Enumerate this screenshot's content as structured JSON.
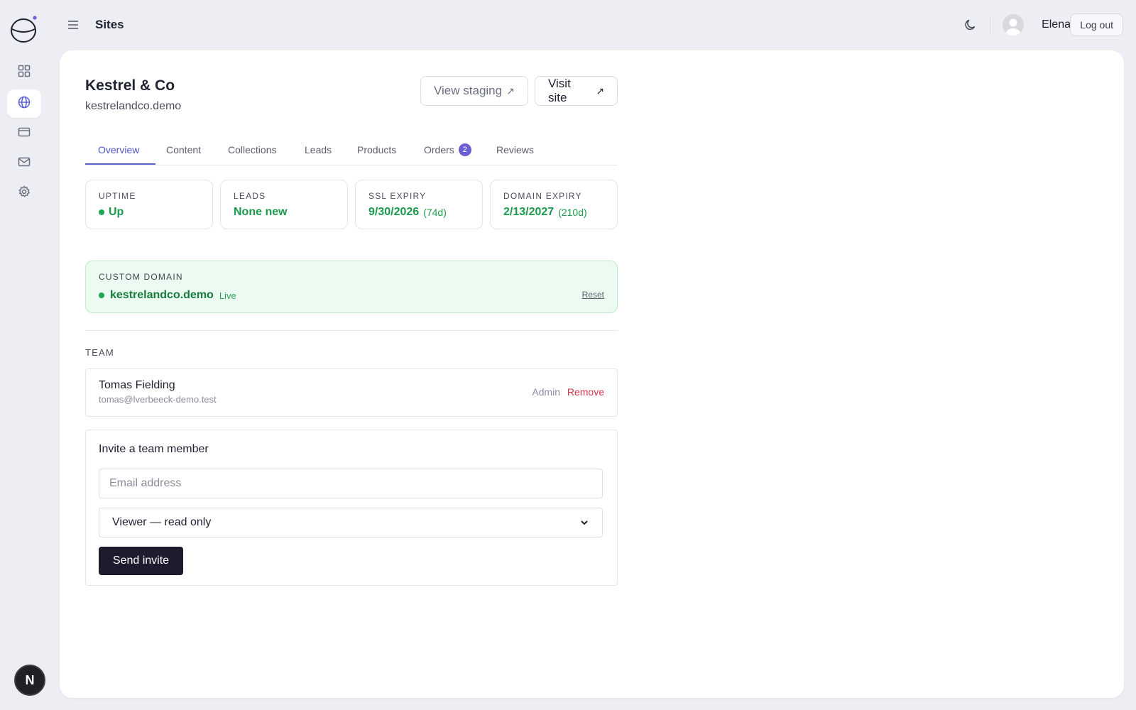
{
  "topbar": {
    "title": "Sites",
    "user_name": "Elena",
    "logout_label": "Log out"
  },
  "sidebar": {
    "items": [
      {
        "icon": "grid-icon",
        "active": false
      },
      {
        "icon": "globe-icon",
        "active": true
      },
      {
        "icon": "credit-card-icon",
        "active": false
      },
      {
        "icon": "mail-icon",
        "active": false
      },
      {
        "icon": "gear-icon",
        "active": false
      }
    ],
    "badge_letter": "N"
  },
  "site": {
    "title": "Kestrel & Co",
    "domain": "kestrelandco.demo",
    "view_staging_label": "View staging",
    "visit_site_label": "Visit site",
    "arrow": "↗"
  },
  "tabs": [
    {
      "label": "Overview",
      "active": true
    },
    {
      "label": "Content"
    },
    {
      "label": "Collections"
    },
    {
      "label": "Leads"
    },
    {
      "label": "Products"
    },
    {
      "label": "Orders",
      "count": "2"
    },
    {
      "label": "Reviews"
    }
  ],
  "stats": [
    {
      "label": "UPTIME",
      "value": "Up"
    },
    {
      "label": "LEADS",
      "value": "None new"
    },
    {
      "label": "SSL EXPIRY",
      "value": "9/30/2026",
      "sub": "(74d)"
    },
    {
      "label": "DOMAIN EXPIRY",
      "value": "2/13/2027",
      "sub": "(210d)"
    }
  ],
  "custom_domain": {
    "label": "CUSTOM DOMAIN",
    "name": "kestrelandco.demo",
    "status": "Live",
    "reset_label": "Reset"
  },
  "team": {
    "label": "TEAM",
    "members": [
      {
        "name": "Tomas Fielding",
        "email": "tomas@lverbeeck-demo.test",
        "role": "Admin",
        "remove_label": "Remove"
      }
    ]
  },
  "invite": {
    "title": "Invite a team member",
    "email_placeholder": "Email address",
    "role_selected": "Viewer — read only",
    "send_label": "Send invite"
  },
  "colors": {
    "accent": "#5b5fc7",
    "success": "#1b9a4c",
    "danger": "#d1394b",
    "primary_button": "#1c1c2e"
  }
}
